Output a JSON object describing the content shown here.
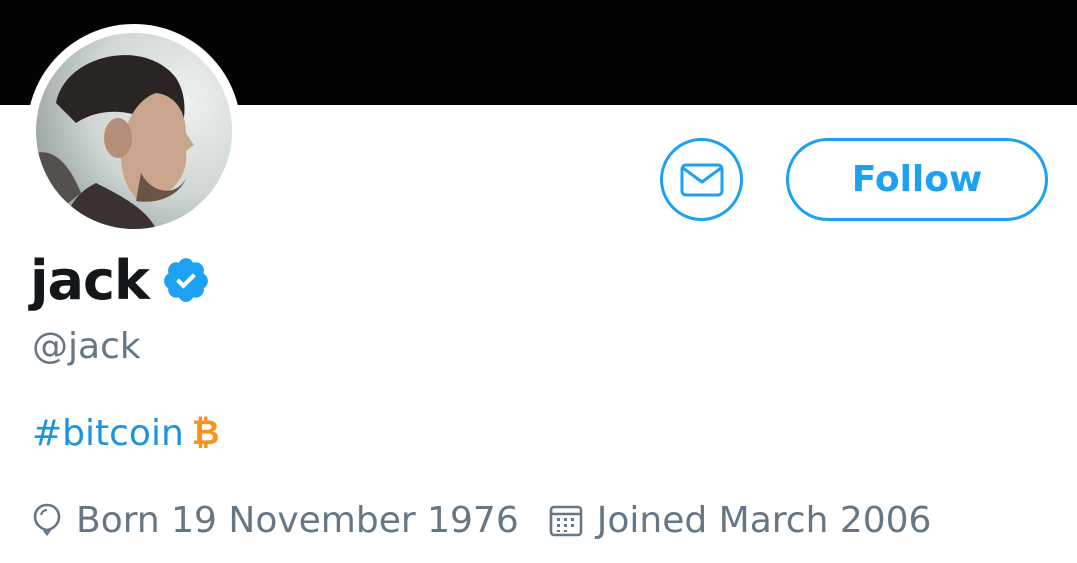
{
  "profile": {
    "display_name": "jack",
    "handle": "@jack",
    "verified": true,
    "bio": {
      "hashtag": "#bitcoin",
      "emoji": "₿"
    },
    "born": "Born 19 November 1976",
    "joined": "Joined March 2006"
  },
  "actions": {
    "follow_label": "Follow",
    "message_icon": "envelope-icon"
  },
  "colors": {
    "accent": "#1da1f2",
    "link": "#1b95e0",
    "bitcoin": "#f7931a",
    "muted_text": "#657786",
    "name_text": "#14171a",
    "banner": "#030303"
  }
}
